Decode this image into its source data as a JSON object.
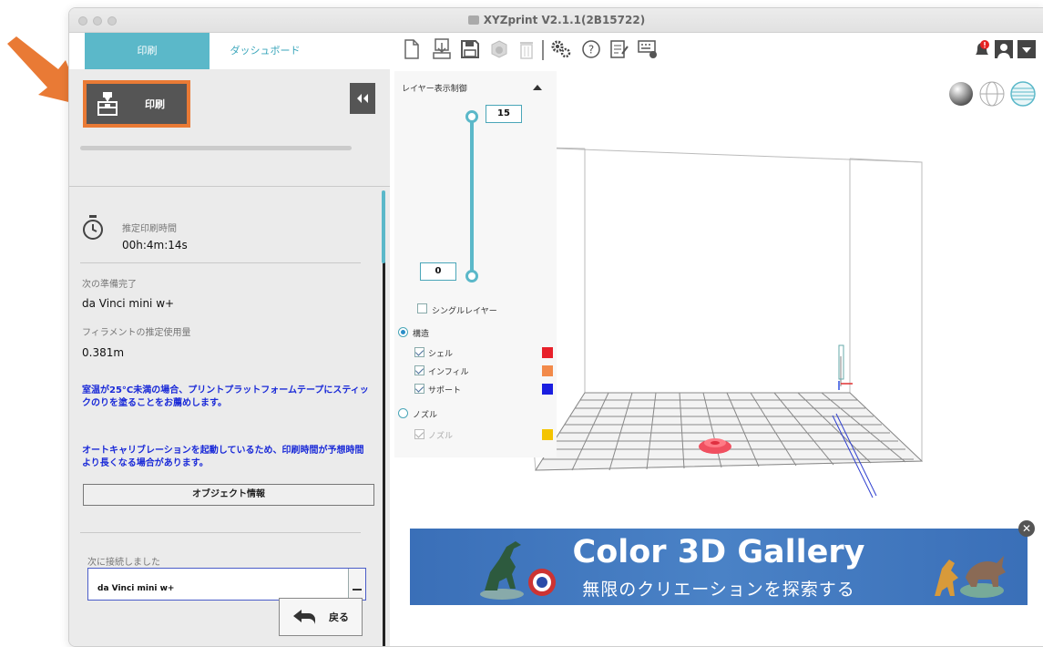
{
  "window": {
    "title": "XYZprint V2.1.1(2B15722)"
  },
  "tabs": [
    {
      "label": "印刷",
      "active": true
    },
    {
      "label": "ダッシュボード",
      "active": false
    }
  ],
  "toolbar": {
    "icons": [
      "new-file-icon",
      "import-icon",
      "save-icon",
      "object-icon",
      "delete-icon",
      "settings-icon",
      "help-icon",
      "notes-icon",
      "keyboard-icon"
    ],
    "right_icons": [
      "notification-icon",
      "user-icon",
      "dropdown-icon"
    ]
  },
  "sidebar": {
    "print_button_label": "印刷",
    "estimate_label": "推定印刷時間",
    "estimate_value": "00h:4m:14s",
    "next_ready_label": "次の準備完了",
    "printer_name": "da Vinci mini w+",
    "filament_label": "フィラメントの推定使用量",
    "filament_value": "0.381m",
    "warning1": "室温が25°C未満の場合、プリントプラットフォームテープにスティックのりを塗ることをお薦めします。",
    "warning2": "オートキャリブレーションを起動しているため、印刷時間が予想時間より長くなる場合があります。",
    "object_info_button": "オブジェクト情報",
    "connected_label": "次に接続しました",
    "connected_device": "da Vinci mini w+",
    "back_button": "戻る"
  },
  "layer_panel": {
    "title": "レイヤー表示制御",
    "top_value": "15",
    "bottom_value": "0",
    "single_layer": "シングルレイヤー",
    "structure_label": "構造",
    "items": [
      {
        "label": "シェル",
        "color": "#e8202a",
        "checked": true
      },
      {
        "label": "インフィル",
        "color": "#f28a4a",
        "checked": true
      },
      {
        "label": "サポート",
        "color": "#1a1ee0",
        "checked": true
      }
    ],
    "nozzle_label": "ノズル",
    "nozzle_item": {
      "label": "ノズル",
      "color": "#f4c400",
      "checked": true
    }
  },
  "ad": {
    "title": "Color 3D Gallery",
    "subtitle": "無限のクリエーションを探索する"
  },
  "colors": {
    "accent": "#5bb8c9",
    "highlight": "#e97a35",
    "warning_text": "#1a2ad8"
  }
}
